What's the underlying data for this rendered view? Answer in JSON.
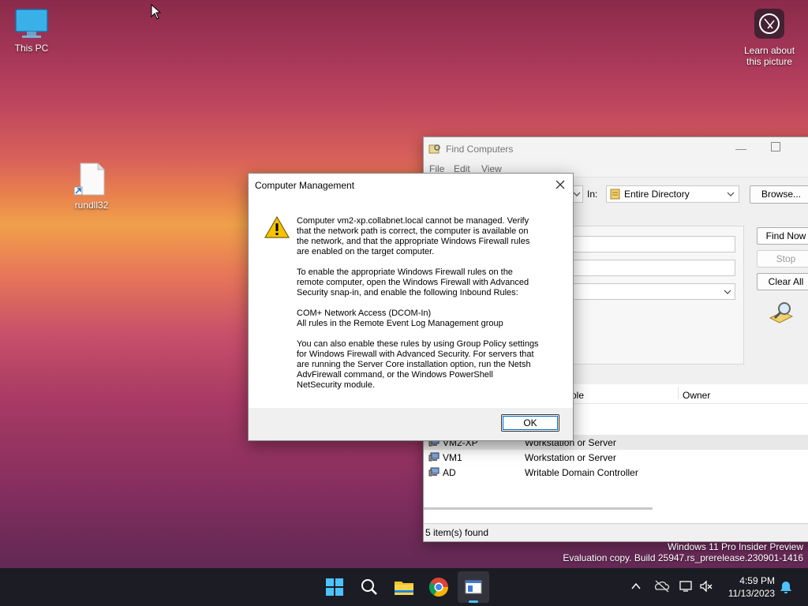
{
  "desktop": {
    "icons": [
      {
        "label": "This PC"
      },
      {
        "label": "rundll32"
      }
    ],
    "learn_about": {
      "line1": "Learn about",
      "line2": "this picture"
    },
    "watermark": {
      "line1": "Windows 11 Pro Insider Preview",
      "line2": "Evaluation copy. Build 25947.rs_prerelease.230901-1416"
    }
  },
  "find_computers": {
    "title": "Find Computers",
    "menu": [
      "File",
      "Edit",
      "View"
    ],
    "in_label": "In:",
    "in_value": "Entire Directory",
    "browse_button": "Browse...",
    "find_now_button": "Find Now",
    "stop_button": "Stop",
    "clear_all_button": "Clear All",
    "columns": {
      "role": "ole",
      "owner": "Owner"
    },
    "rows": [
      {
        "name": "",
        "type": "n or Server"
      },
      {
        "name": "",
        "type": "n or Server"
      },
      {
        "name": "VM2-XP",
        "type": "Workstation or Server"
      },
      {
        "name": "VM1",
        "type": "Workstation or Server"
      },
      {
        "name": "AD",
        "type": "Writable Domain Controller"
      }
    ],
    "status": "5 item(s) found"
  },
  "dialog": {
    "title": "Computer Management",
    "para1": "Computer vm2-xp.collabnet.local cannot be managed. Verify\nthat the network path is correct, the computer is available on\nthe network, and that the appropriate Windows Firewall rules\nare enabled on the target computer.",
    "para2": "To enable the appropriate Windows Firewall rules on the\nremote computer, open the Windows Firewall with Advanced\nSecurity snap-in, and enable the following Inbound Rules:",
    "para3": "COM+ Network Access (DCOM-In)\nAll rules in the Remote Event Log Management group",
    "para4": "You can also enable these rules by using Group Policy settings\nfor Windows Firewall with Advanced Security. For servers that\nare running the Server Core installation option, run the Netsh\nAdvFirewall command, or the Windows PowerShell\nNetSecurity module.",
    "ok_button": "OK"
  },
  "taskbar": {
    "time": "4:59 PM",
    "date": "11/13/2023",
    "icons": [
      "start-icon",
      "search-icon",
      "file-explorer-icon",
      "chrome-icon",
      "active-app-icon"
    ]
  }
}
